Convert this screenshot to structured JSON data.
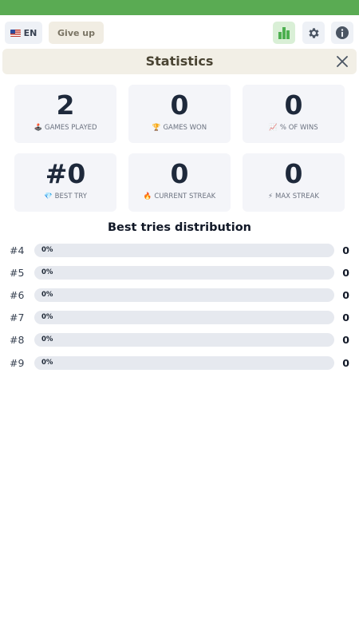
{
  "toolbar": {
    "language": "EN",
    "language_flag_icon": "us-flag-icon",
    "give_up_label": "Give up",
    "icons": {
      "stats": "bar-chart-icon",
      "settings": "gear-icon",
      "info": "info-icon"
    },
    "colors": {
      "stats_active": "#4caf50",
      "top_bar": "#5aab53"
    }
  },
  "statistics": {
    "title": "Statistics",
    "close_icon": "close-icon",
    "cards": [
      {
        "value": "2",
        "label": "GAMES PLAYED",
        "icon": "🕹️"
      },
      {
        "value": "0",
        "label": "GAMES WON",
        "icon": "🏆"
      },
      {
        "value": "0",
        "label": "% OF WINS",
        "icon": "📈"
      },
      {
        "value": "#0",
        "label": "BEST TRY",
        "icon": "💎"
      },
      {
        "value": "0",
        "label": "CURRENT STREAK",
        "icon": "🔥"
      },
      {
        "value": "0",
        "label": "MAX STREAK",
        "icon": "⚡"
      }
    ],
    "distribution": {
      "title": "Best tries distribution",
      "rows": [
        {
          "label": "#4",
          "percent_text": "0%",
          "percent": 0,
          "count": "0"
        },
        {
          "label": "#5",
          "percent_text": "0%",
          "percent": 0,
          "count": "0"
        },
        {
          "label": "#6",
          "percent_text": "0%",
          "percent": 0,
          "count": "0"
        },
        {
          "label": "#7",
          "percent_text": "0%",
          "percent": 0,
          "count": "0"
        },
        {
          "label": "#8",
          "percent_text": "0%",
          "percent": 0,
          "count": "0"
        },
        {
          "label": "#9",
          "percent_text": "0%",
          "percent": 0,
          "count": "0"
        }
      ]
    }
  }
}
